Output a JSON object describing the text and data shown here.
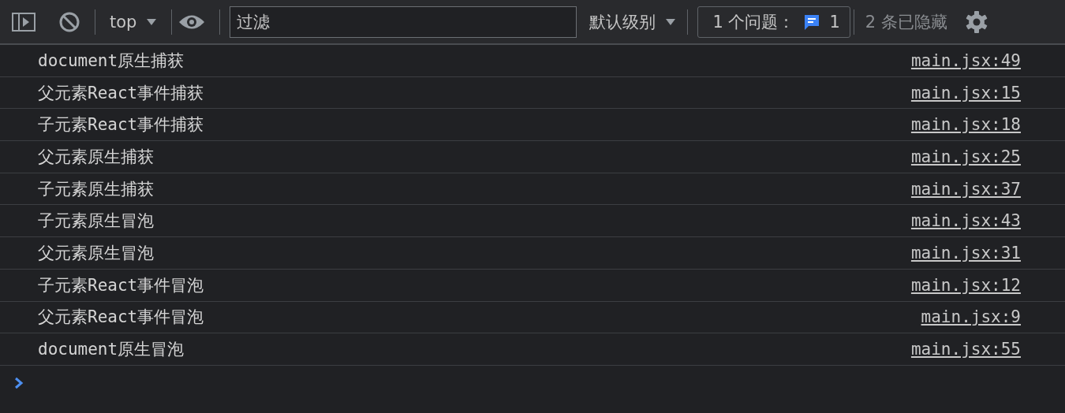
{
  "toolbar": {
    "context": "top",
    "filter": {
      "placeholder": "过滤"
    },
    "level": "默认级别",
    "issues": {
      "label": "1 个问题：",
      "count": "1"
    },
    "hidden": "2 条已隐藏"
  },
  "messages": [
    {
      "text": "document原生捕获",
      "source": "main.jsx:49"
    },
    {
      "text": "父元素React事件捕获",
      "source": "main.jsx:15"
    },
    {
      "text": "子元素React事件捕获",
      "source": "main.jsx:18"
    },
    {
      "text": "父元素原生捕获",
      "source": "main.jsx:25"
    },
    {
      "text": "子元素原生捕获",
      "source": "main.jsx:37"
    },
    {
      "text": "子元素原生冒泡",
      "source": "main.jsx:43"
    },
    {
      "text": "父元素原生冒泡",
      "source": "main.jsx:31"
    },
    {
      "text": "子元素React事件冒泡",
      "source": "main.jsx:12"
    },
    {
      "text": "父元素React事件冒泡",
      "source": "main.jsx:9"
    },
    {
      "text": "document原生冒泡",
      "source": "main.jsx:55"
    }
  ]
}
